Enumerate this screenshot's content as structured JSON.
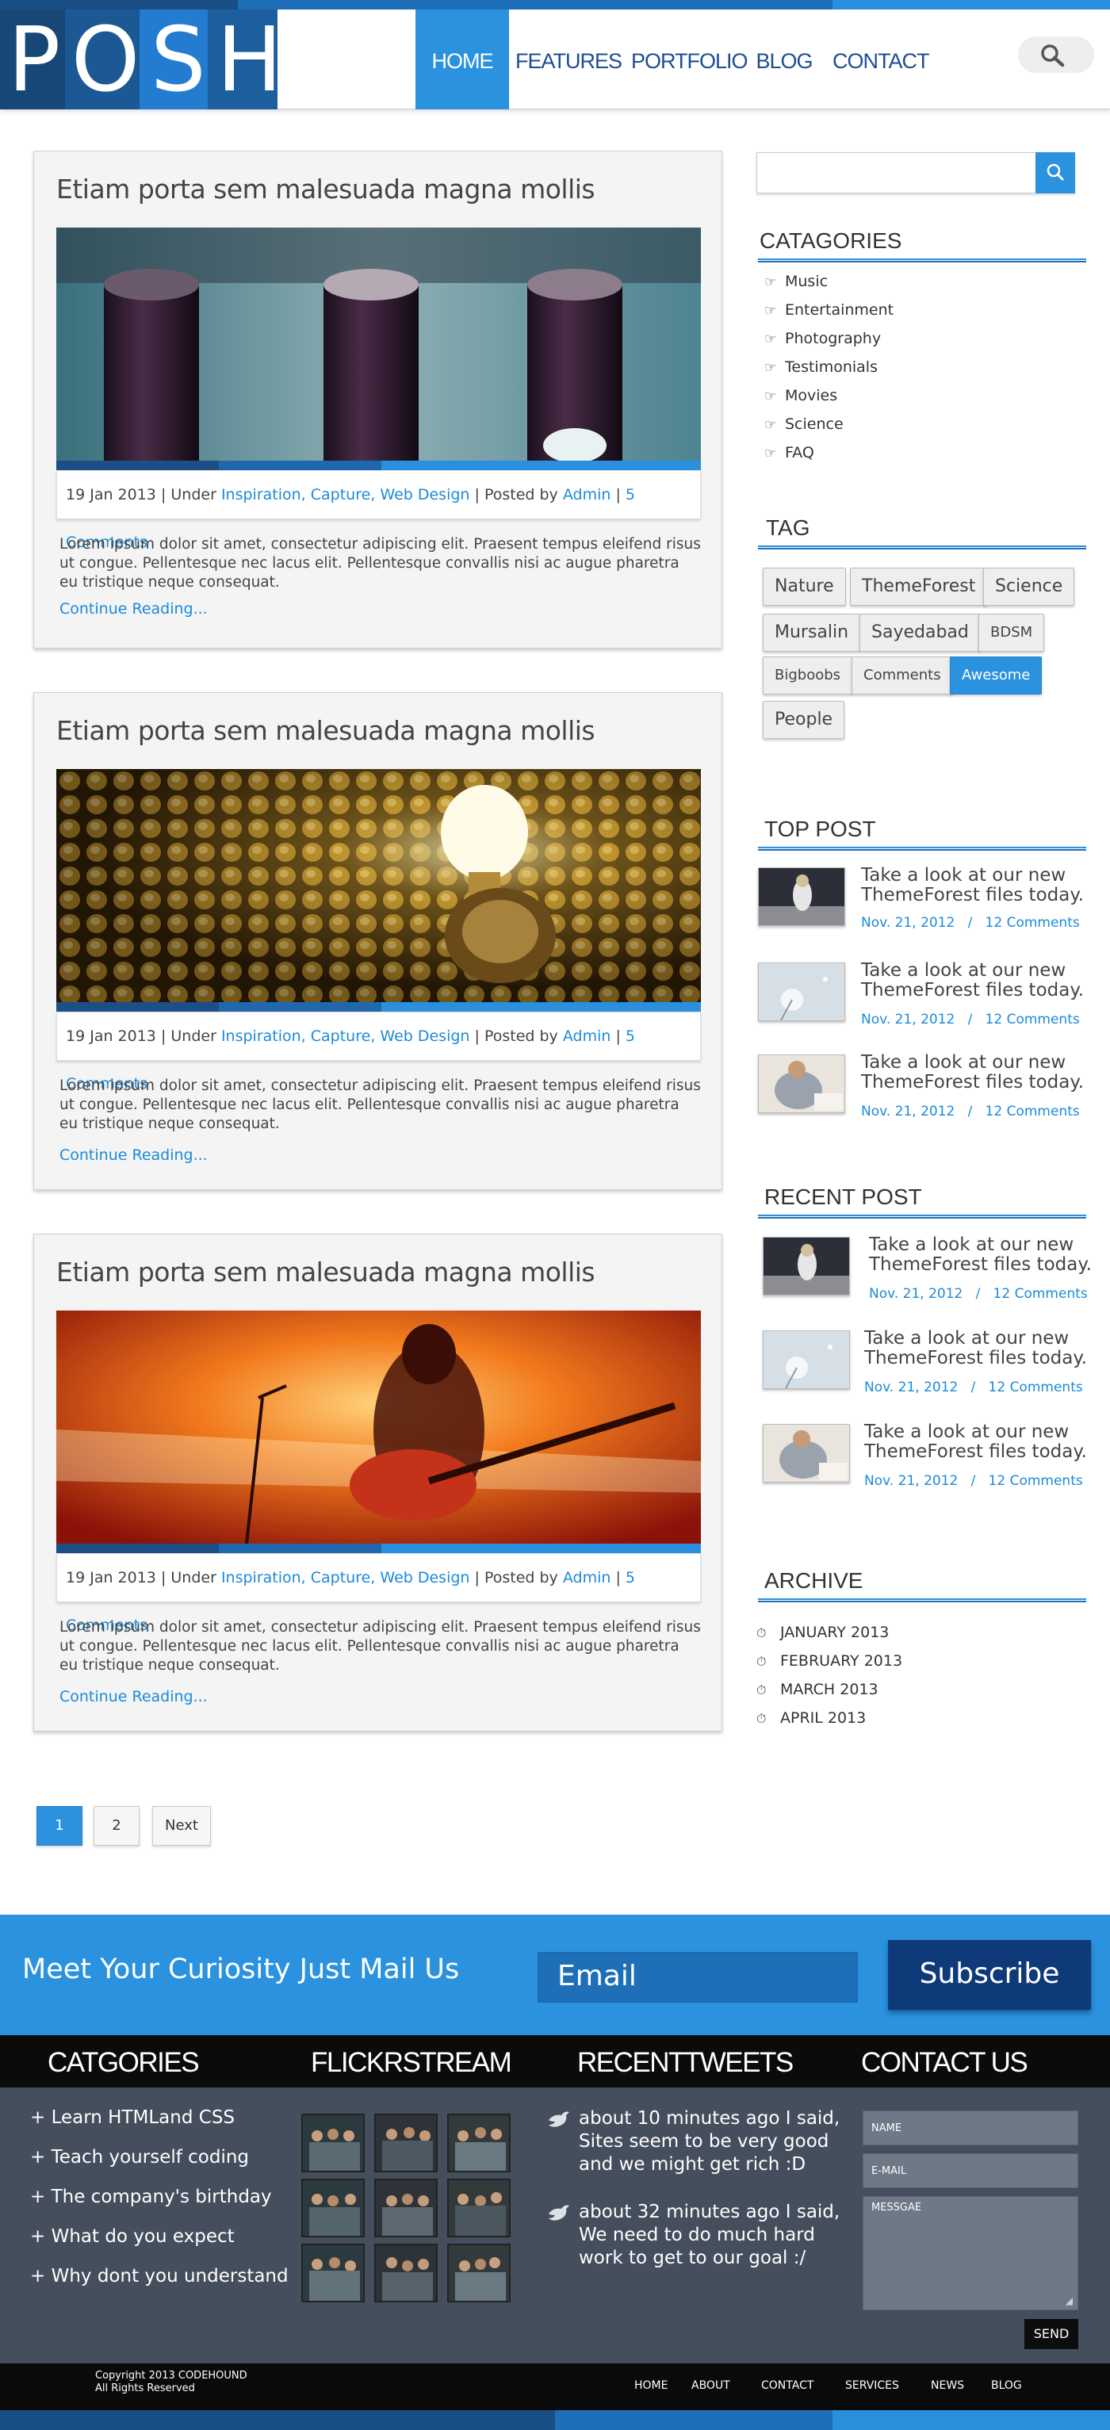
{
  "header": {
    "logo": "POSH",
    "nav": [
      "HOME",
      "FEATURES",
      "PORTFOLIO",
      "BLOG",
      "CONTACT"
    ]
  },
  "posts": [
    {
      "title": "Etiam porta sem malesuada magna mollis",
      "date": "19 Jan 2013",
      "under": "Under",
      "categories": "Inspiration, Capture, Web Design",
      "posted_by": "Posted by",
      "author": "Admin",
      "comments": "5 Comments",
      "excerpt": "Lorem ipsum dolor sit amet, consectetur adipiscing elit. Praesent tempus eleifend risus ut congue. Pellentesque nec lacus elit. Pellentesque convallis nisi ac augue pharetra eu tristique neque consequat.",
      "more": "Continue Reading..."
    },
    {
      "title": "Etiam porta sem malesuada magna mollis",
      "date": "19 Jan 2013",
      "under": "Under",
      "categories": "Inspiration, Capture, Web Design",
      "posted_by": "Posted by",
      "author": "Admin",
      "comments": "5 Comments",
      "excerpt": "Lorem ipsum dolor sit amet, consectetur adipiscing elit. Praesent tempus eleifend risus ut congue. Pellentesque nec lacus elit. Pellentesque convallis nisi ac augue pharetra eu tristique neque consequat.",
      "more": "Continue Reading..."
    },
    {
      "title": "Etiam porta sem malesuada magna mollis",
      "date": "19 Jan 2013",
      "under": "Under",
      "categories": "Inspiration, Capture, Web Design",
      "posted_by": "Posted by",
      "author": "Admin",
      "comments": "5 Comments",
      "excerpt": "Lorem ipsum dolor sit amet, consectetur adipiscing elit. Praesent tempus eleifend risus ut congue. Pellentesque nec lacus elit. Pellentesque convallis nisi ac augue pharetra eu tristique neque consequat.",
      "more": "Continue Reading..."
    }
  ],
  "pagination": {
    "pages": [
      "1",
      "2"
    ],
    "next": "Next",
    "current": "1"
  },
  "sidebar": {
    "categories_title": "CATAGORIES",
    "categories": [
      "Music",
      "Entertainment",
      "Photography",
      "Testimonials",
      "Movies",
      "Science",
      "FAQ"
    ],
    "tag_title": "TAG",
    "tags": [
      "Nature",
      "ThemeForest",
      "Science",
      "Mursalin",
      "Sayedabad",
      "BDSM",
      "Bigboobs",
      "Comments",
      "Awesome",
      "People"
    ],
    "active_tag": "Awesome",
    "top_title": "TOP POST",
    "top_posts": [
      {
        "title": "Take a look at our new ThemeForest files today.",
        "date": "Nov. 21, 2012",
        "sep": "/",
        "comments": "12 Comments"
      },
      {
        "title": "Take a look at our new ThemeForest files today.",
        "date": "Nov. 21, 2012",
        "sep": "/",
        "comments": "12 Comments"
      },
      {
        "title": "Take a look at our new ThemeForest files today.",
        "date": "Nov. 21, 2012",
        "sep": "/",
        "comments": "12 Comments"
      }
    ],
    "recent_title": "RECENT POST",
    "recent_posts": [
      {
        "title": "Take a look at our new ThemeForest files today.",
        "date": "Nov. 21, 2012",
        "sep": "/",
        "comments": "12 Comments"
      },
      {
        "title": "Take a look at our new ThemeForest files today.",
        "date": "Nov. 21, 2012",
        "sep": "/",
        "comments": "12 Comments"
      },
      {
        "title": "Take a look at our new ThemeForest files today.",
        "date": "Nov. 21, 2012",
        "sep": "/",
        "comments": "12 Comments"
      }
    ],
    "archive_title": "ARCHIVE",
    "archive": [
      "JANUARY 2013",
      "FEBRUARY 2013",
      "MARCH 2013",
      "APRIL 2013"
    ]
  },
  "newsletter": {
    "text": "Meet Your Curiosity Just Mail Us",
    "placeholder": "Email",
    "button": "Subscribe"
  },
  "footer": {
    "cat_title": "CATGORIES",
    "cats": [
      "+ Learn HTMLand CSS",
      "+ Teach yourself coding",
      "+ The company's birthday",
      "+ What do you expect",
      "+ Why dont you understand"
    ],
    "flickr_title": "FLICKRSTREAM",
    "tweets_title": "RECENTTWEETS",
    "tweets": [
      "about 10 minutes ago I said, Sites seem to be very good and we might get rich :D",
      "about 32 minutes ago I said, We need to do much hard work to get to our goal :/"
    ],
    "contact_title": "CONTACT US",
    "name_ph": "NAME",
    "email_ph": "E-MAIL",
    "msg_ph": "MESSGAE",
    "send": "SEND",
    "copyright": "Copyright 2013 CODEHOUND",
    "rights": "All Rights Reserved",
    "links": [
      "HOME",
      "ABOUT",
      "CONTACT",
      "SERVICES",
      "NEWS",
      "BLOG"
    ]
  },
  "colors": {
    "accent": "#2a92df",
    "nav": "#1e4d92",
    "link": "#1c8ad8",
    "dark": "#0b0b0b",
    "footer": "#454e5c"
  }
}
